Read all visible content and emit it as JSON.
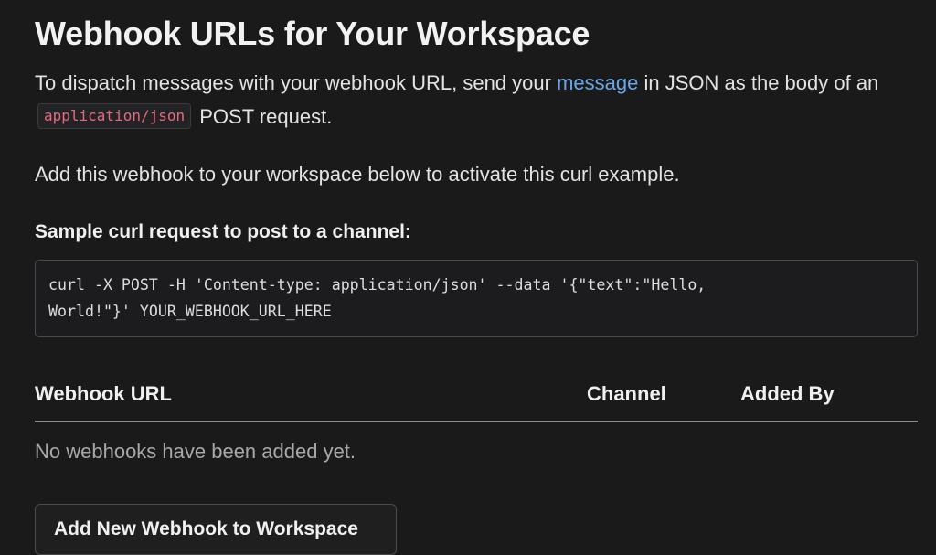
{
  "page": {
    "title": "Webhook URLs for Your Workspace"
  },
  "intro": {
    "text_before_link": "To dispatch messages with your webhook URL, send your ",
    "link_text": "message",
    "text_after_link": " in JSON as the body of an",
    "inline_code": "application/json",
    "text_after_code": " POST request."
  },
  "activate_note": "Add this webhook to your workspace below to activate this curl example.",
  "sample": {
    "label": "Sample curl request to post to a channel:",
    "code": "curl -X POST -H 'Content-type: application/json' --data '{\"text\":\"Hello,\nWorld!\"}' YOUR_WEBHOOK_URL_HERE"
  },
  "table": {
    "columns": [
      "Webhook URL",
      "Channel",
      "Added By"
    ],
    "empty_message": "No webhooks have been added yet."
  },
  "actions": {
    "add_button_label": "Add New Webhook to Workspace"
  }
}
